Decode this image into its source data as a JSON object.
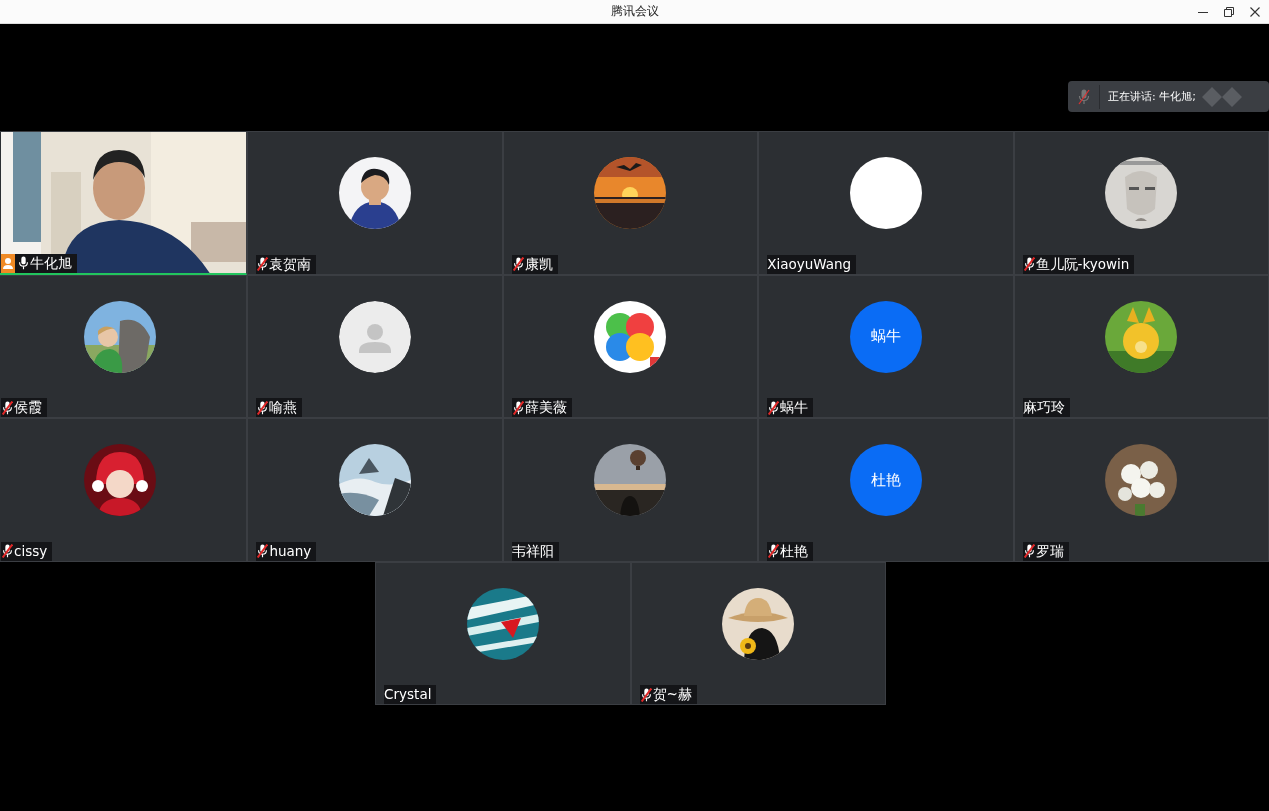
{
  "window": {
    "title": "腾讯会议"
  },
  "speaking": {
    "muted": true,
    "text": "正在讲话: 牛化旭;"
  },
  "tile_rows": [
    {
      "tiles": [
        {
          "name": "牛化旭",
          "kind": "video",
          "mic_icon": true,
          "muted": false,
          "host": true,
          "active": true
        },
        {
          "name": "袁贺南",
          "kind": "picture",
          "mic_icon": true,
          "muted": true,
          "host": false,
          "active": false
        },
        {
          "name": "康凯",
          "kind": "picture",
          "mic_icon": true,
          "muted": true,
          "host": false,
          "active": false
        },
        {
          "name": "XiaoyuWang",
          "kind": "blank",
          "mic_icon": false,
          "host": false,
          "active": false
        },
        {
          "name": "鱼儿阮-kyowin",
          "kind": "picture",
          "mic_icon": true,
          "muted": true,
          "host": false,
          "active": false
        }
      ]
    },
    {
      "tiles": [
        {
          "name": "侯霞",
          "kind": "picture",
          "mic_icon": true,
          "muted": true,
          "host": false,
          "active": false
        },
        {
          "name": "喻燕",
          "kind": "placeholder",
          "mic_icon": true,
          "muted": true,
          "host": false,
          "active": false
        },
        {
          "name": "薛美薇",
          "kind": "picture",
          "mic_icon": true,
          "muted": true,
          "host": false,
          "active": false
        },
        {
          "name": "蜗牛",
          "kind": "initials",
          "initials": "蜗牛",
          "mic_icon": true,
          "muted": true,
          "host": false,
          "active": false
        },
        {
          "name": "麻巧玲",
          "kind": "picture",
          "mic_icon": false,
          "host": false,
          "active": false
        }
      ]
    },
    {
      "tiles": [
        {
          "name": "cissy",
          "kind": "picture",
          "mic_icon": true,
          "muted": true,
          "host": false,
          "active": false
        },
        {
          "name": "huany",
          "kind": "picture",
          "mic_icon": true,
          "muted": true,
          "host": false,
          "active": false
        },
        {
          "name": "韦祥阳",
          "kind": "picture",
          "mic_icon": false,
          "host": false,
          "active": false
        },
        {
          "name": "杜艳",
          "kind": "initials",
          "initials": "杜艳",
          "mic_icon": true,
          "muted": true,
          "host": false,
          "active": false
        },
        {
          "name": "罗瑞",
          "kind": "picture",
          "mic_icon": true,
          "muted": true,
          "host": false,
          "active": false
        }
      ]
    },
    {
      "tiles": [
        {
          "name": "Crystal",
          "kind": "picture",
          "mic_icon": false,
          "host": false,
          "active": false
        },
        {
          "name": "贺~赫",
          "kind": "picture",
          "mic_icon": true,
          "muted": true,
          "host": false,
          "active": false
        }
      ]
    }
  ]
}
